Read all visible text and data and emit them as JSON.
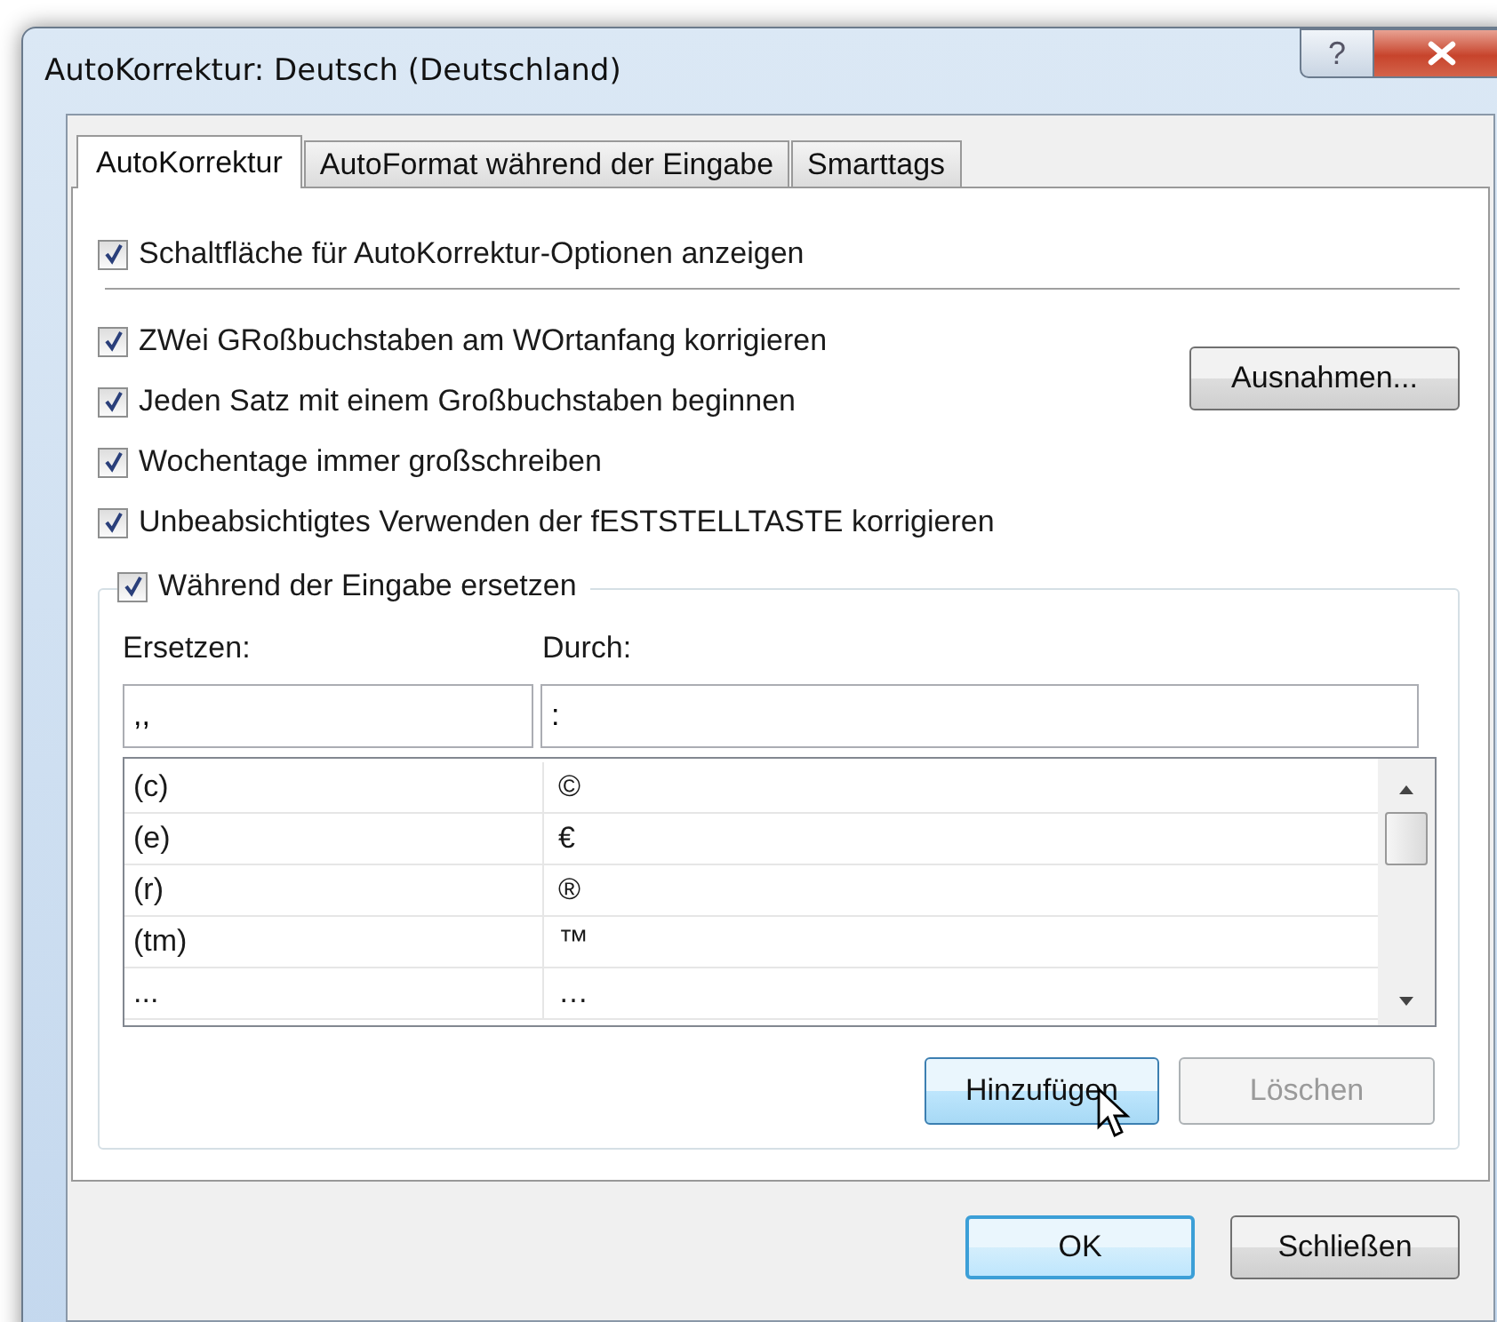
{
  "window": {
    "title": "AutoKorrektur: Deutsch (Deutschland)",
    "help_button": "?"
  },
  "tabs": [
    {
      "label": "AutoKorrektur",
      "selected": true
    },
    {
      "label": "AutoFormat während der Eingabe",
      "selected": false
    },
    {
      "label": "Smarttags",
      "selected": false
    }
  ],
  "top_option": {
    "label": "Schaltfläche für AutoKorrektur-Optionen anzeigen",
    "checked": true
  },
  "options": [
    {
      "label": "ZWei GRoßbuchstaben am WOrtanfang korrigieren",
      "checked": true
    },
    {
      "label": "Jeden Satz mit einem Großbuchstaben beginnen",
      "checked": true
    },
    {
      "label": "Wochentage immer großschreiben",
      "checked": true
    },
    {
      "label": "Unbeabsichtigtes Verwenden der fESTSTELLTASTE korrigieren",
      "checked": true
    }
  ],
  "exceptions_button": "Ausnahmen...",
  "replace_group": {
    "label": "Während der Eingabe ersetzen",
    "checked": true,
    "replace_label": "Ersetzen:",
    "with_label": "Durch:",
    "replace_value": ",,",
    "with_value": ":",
    "rows": [
      {
        "replace": "(c)",
        "with": "©"
      },
      {
        "replace": "(e)",
        "with": "€"
      },
      {
        "replace": "(r)",
        "with": "®"
      },
      {
        "replace": "(tm)",
        "with": "™"
      },
      {
        "replace": "...",
        "with": "…"
      }
    ],
    "buttons": [
      {
        "label": "Hinzufügen",
        "disabled": false,
        "hovered": true
      },
      {
        "label": "Löschen",
        "disabled": true,
        "hovered": false
      }
    ]
  },
  "footer_buttons": [
    {
      "label": "OK",
      "default": true
    },
    {
      "label": "Schließen",
      "default": false
    }
  ]
}
